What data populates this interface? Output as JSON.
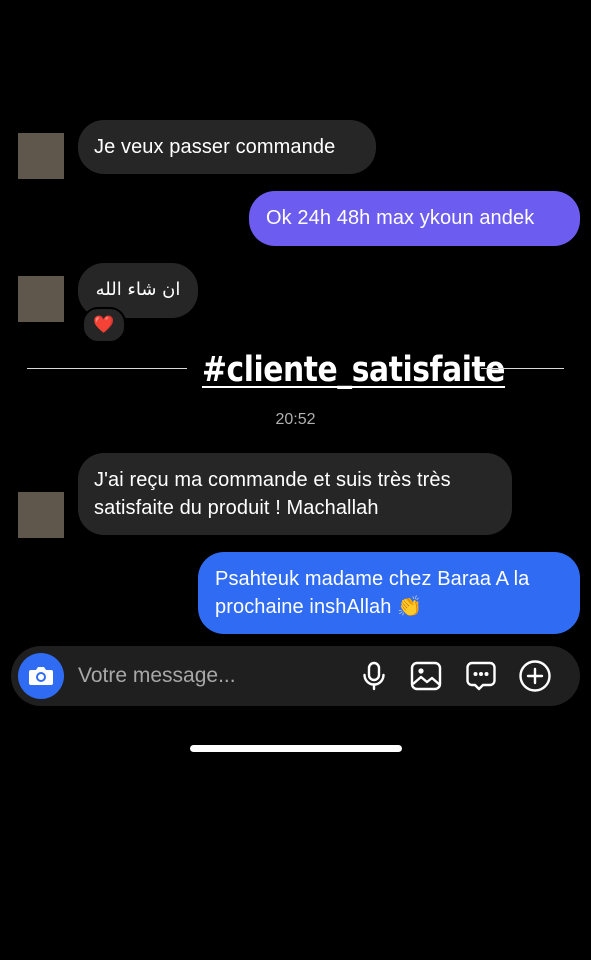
{
  "messages": [
    {
      "sender": "contact",
      "text": "Je veux passer commande"
    },
    {
      "sender": "me",
      "text": "Ok 24h 48h max ykoun andek"
    },
    {
      "sender": "contact",
      "text": "ان شاء الله",
      "reaction": "❤️"
    },
    {
      "sender": "contact",
      "lines": [
        "J'ai reçu ma commande et suis très très",
        "satisfaite du produit ! Machallah"
      ]
    },
    {
      "sender": "me",
      "lines": [
        "Psahteuk madame chez Baraa A la",
        "prochaine inshAllah 👏"
      ]
    }
  ],
  "overlay": {
    "hashtag": "#cliente_satisfaite"
  },
  "timestamp": "20:52",
  "composer": {
    "placeholder": "Votre message...",
    "icons": [
      "camera-icon",
      "microphone-icon",
      "gallery-icon",
      "sticker-icon",
      "plus-icon"
    ]
  },
  "colors": {
    "background": "#000000",
    "incoming_bubble": "#262626",
    "outgoing_purple": "#6c5cf0",
    "outgoing_blue": "#2f6cf3",
    "accent": "#2f6cf3"
  }
}
